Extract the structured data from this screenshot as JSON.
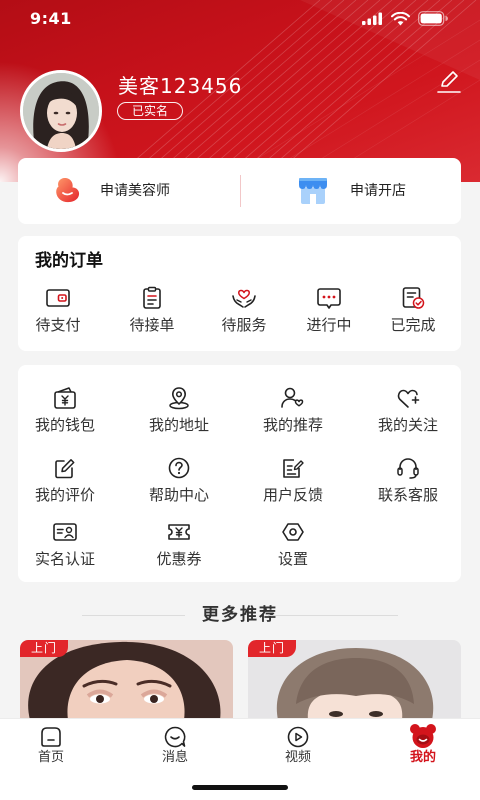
{
  "status_bar": {
    "time": "9:41",
    "icons": [
      "signal-icon",
      "wifi-icon",
      "battery-icon"
    ]
  },
  "profile": {
    "name": "美客123456",
    "verified_badge": "已实名",
    "edit_icon": "edit-icon"
  },
  "apply_card": {
    "items": [
      {
        "label": "申请美容师",
        "icon": "beautician-icon"
      },
      {
        "label": "申请开店",
        "icon": "shop-icon"
      }
    ]
  },
  "orders": {
    "title": "我的订单",
    "items": [
      {
        "label": "待支付",
        "icon": "pending-payment-icon"
      },
      {
        "label": "待接单",
        "icon": "pending-accept-icon"
      },
      {
        "label": "待服务",
        "icon": "pending-service-icon"
      },
      {
        "label": "进行中",
        "icon": "in-progress-icon"
      },
      {
        "label": "已完成",
        "icon": "completed-icon"
      }
    ]
  },
  "services": {
    "items": [
      {
        "label": "我的钱包",
        "icon": "wallet-icon"
      },
      {
        "label": "我的地址",
        "icon": "location-icon"
      },
      {
        "label": "我的推荐",
        "icon": "referral-icon"
      },
      {
        "label": "我的关注",
        "icon": "follow-icon"
      },
      {
        "label": "我的评价",
        "icon": "review-icon"
      },
      {
        "label": "帮助中心",
        "icon": "help-icon"
      },
      {
        "label": "用户反馈",
        "icon": "feedback-icon"
      },
      {
        "label": "联系客服",
        "icon": "headset-icon"
      },
      {
        "label": "实名认证",
        "icon": "id-card-icon"
      },
      {
        "label": "优惠券",
        "icon": "coupon-icon"
      },
      {
        "label": "设置",
        "icon": "settings-icon"
      }
    ]
  },
  "recommend": {
    "title": "更多推荐",
    "cards": [
      {
        "badge": "上门"
      },
      {
        "badge": "上门"
      }
    ]
  },
  "tab_bar": {
    "items": [
      {
        "label": "首页",
        "icon": "home-icon",
        "active": false
      },
      {
        "label": "消息",
        "icon": "message-icon",
        "active": false
      },
      {
        "label": "视频",
        "icon": "video-icon",
        "active": false
      },
      {
        "label": "我的",
        "icon": "profile-icon",
        "active": true
      }
    ]
  },
  "colors": {
    "accent": "#d3141c",
    "badge": "#e2262b",
    "background": "#f4f4f4",
    "card": "#ffffff",
    "text": "#222222"
  }
}
